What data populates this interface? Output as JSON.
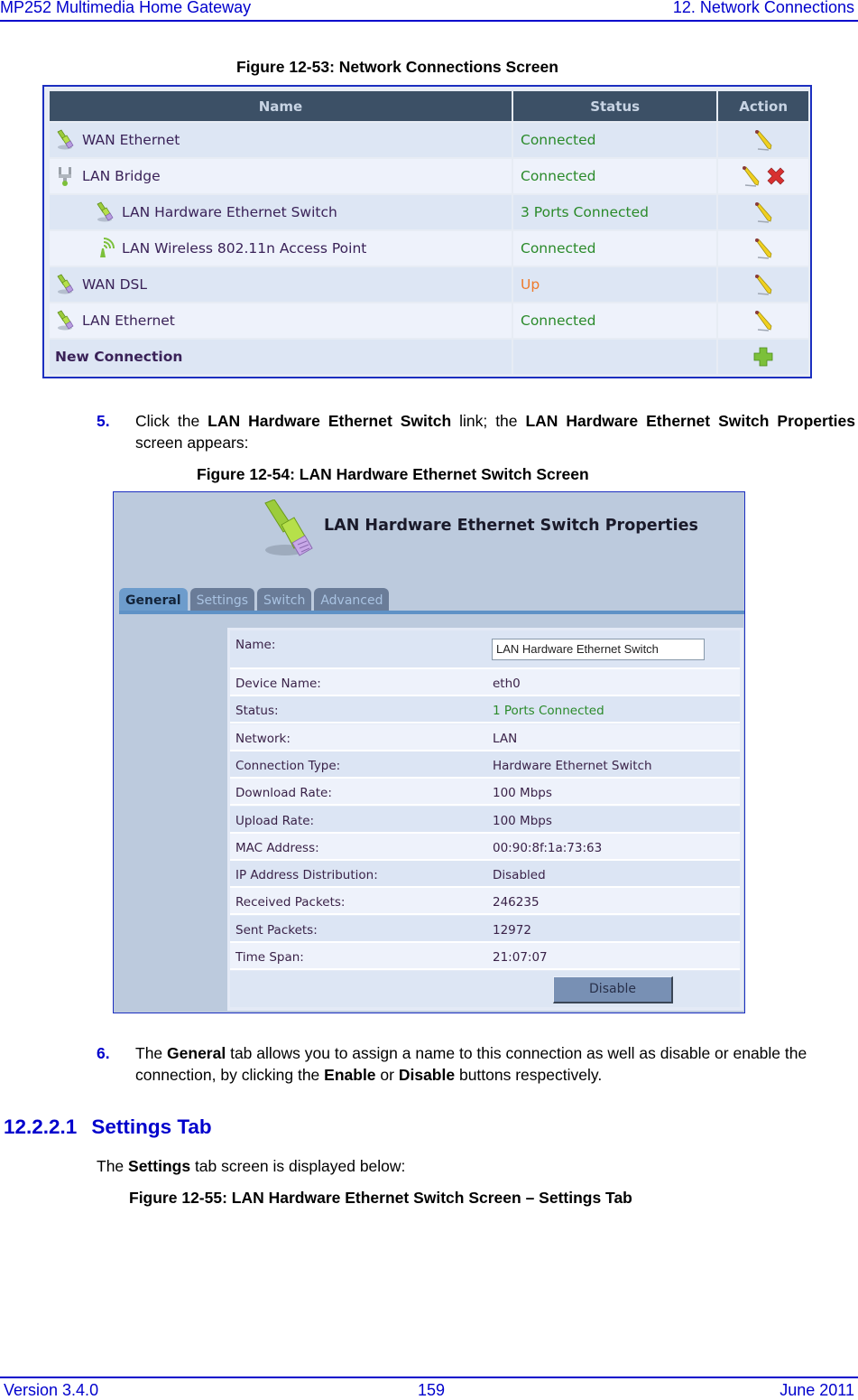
{
  "page_header": {
    "left": "MP252 Multimedia Home Gateway",
    "right": "12. Network Connections"
  },
  "figure_53": {
    "caption": "Figure 12-53: Network Connections Screen",
    "columns": [
      "Name",
      "Status",
      "Action"
    ],
    "rows": [
      {
        "name": "WAN Ethernet",
        "icon": "ethernet-cable-icon",
        "status": "Connected",
        "status_color": "#2a8a2a",
        "actions": [
          "edit"
        ]
      },
      {
        "name": "LAN Bridge",
        "icon": "bridge-icon",
        "status": "Connected",
        "status_color": "#2a8a2a",
        "actions": [
          "edit",
          "delete"
        ]
      },
      {
        "name": "LAN Hardware Ethernet Switch",
        "icon": "ethernet-cable-icon",
        "status": "3 Ports Connected",
        "status_color": "#2a8a2a",
        "actions": [
          "edit"
        ],
        "indent": true
      },
      {
        "name": "LAN Wireless 802.11n Access Point",
        "icon": "wireless-icon",
        "status": "Connected",
        "status_color": "#2a8a2a",
        "actions": [
          "edit"
        ],
        "indent": true
      },
      {
        "name": "WAN DSL",
        "icon": "ethernet-cable-icon",
        "status": "Up",
        "status_color": "#ee7a2a",
        "actions": [
          "edit"
        ]
      },
      {
        "name": "LAN Ethernet",
        "icon": "ethernet-cable-icon",
        "status": "Connected",
        "status_color": "#2a8a2a",
        "actions": [
          "edit"
        ]
      }
    ],
    "new_connection_label": "New Connection"
  },
  "step5": {
    "number": "5.",
    "text_parts": [
      {
        "t": "Click the ",
        "b": false
      },
      {
        "t": "LAN Hardware Ethernet Switch",
        "b": true
      },
      {
        "t": " link; the ",
        "b": false
      },
      {
        "t": "LAN Hardware Ethernet Switch Properties",
        "b": true
      },
      {
        "t": " screen appears:",
        "b": false
      }
    ]
  },
  "figure_54": {
    "caption": "Figure 12-54: LAN Hardware Ethernet Switch Screen",
    "title": "LAN Hardware Ethernet Switch Properties",
    "tabs": [
      {
        "label": "General",
        "active": true
      },
      {
        "label": "Settings",
        "active": false
      },
      {
        "label": "Switch",
        "active": false
      },
      {
        "label": "Advanced",
        "active": false
      }
    ],
    "name_label": "Name:",
    "name_value": "LAN Hardware Ethernet Switch",
    "properties": [
      {
        "label": "Device Name:",
        "value": "eth0"
      },
      {
        "label": "Status:",
        "value": "1 Ports Connected",
        "green": true
      },
      {
        "label": "Network:",
        "value": "LAN"
      },
      {
        "label": "Connection Type:",
        "value": "Hardware Ethernet Switch"
      },
      {
        "label": "Download Rate:",
        "value": "100 Mbps"
      },
      {
        "label": "Upload Rate:",
        "value": "100 Mbps"
      },
      {
        "label": "MAC Address:",
        "value": "00:90:8f:1a:73:63"
      },
      {
        "label": "IP Address Distribution:",
        "value": "Disabled"
      },
      {
        "label": "Received Packets:",
        "value": "246235"
      },
      {
        "label": "Sent Packets:",
        "value": "12972"
      },
      {
        "label": "Time Span:",
        "value": "21:07:07"
      }
    ],
    "disable_button": "Disable"
  },
  "step6": {
    "number": "6.",
    "text_parts": [
      {
        "t": "The ",
        "b": false
      },
      {
        "t": "General",
        "b": true
      },
      {
        "t": " tab allows you to assign a name to this connection as well as disable or enable the connection, by clicking the ",
        "b": false
      },
      {
        "t": "Enable",
        "b": true
      },
      {
        "t": " or ",
        "b": false
      },
      {
        "t": "Disable",
        "b": true
      },
      {
        "t": " buttons respectively.",
        "b": false
      }
    ]
  },
  "section": {
    "number": "12.2.2.1",
    "title": "Settings Tab",
    "intro_parts": [
      {
        "t": "The ",
        "b": false
      },
      {
        "t": "Settings",
        "b": true
      },
      {
        "t": " tab screen is displayed below:",
        "b": false
      }
    ]
  },
  "figure_55": {
    "caption": "Figure 12-55: LAN Hardware Ethernet Switch Screen – Settings Tab"
  },
  "page_footer": {
    "version": "Version 3.4.0",
    "page": "159",
    "date": "June 2011"
  }
}
